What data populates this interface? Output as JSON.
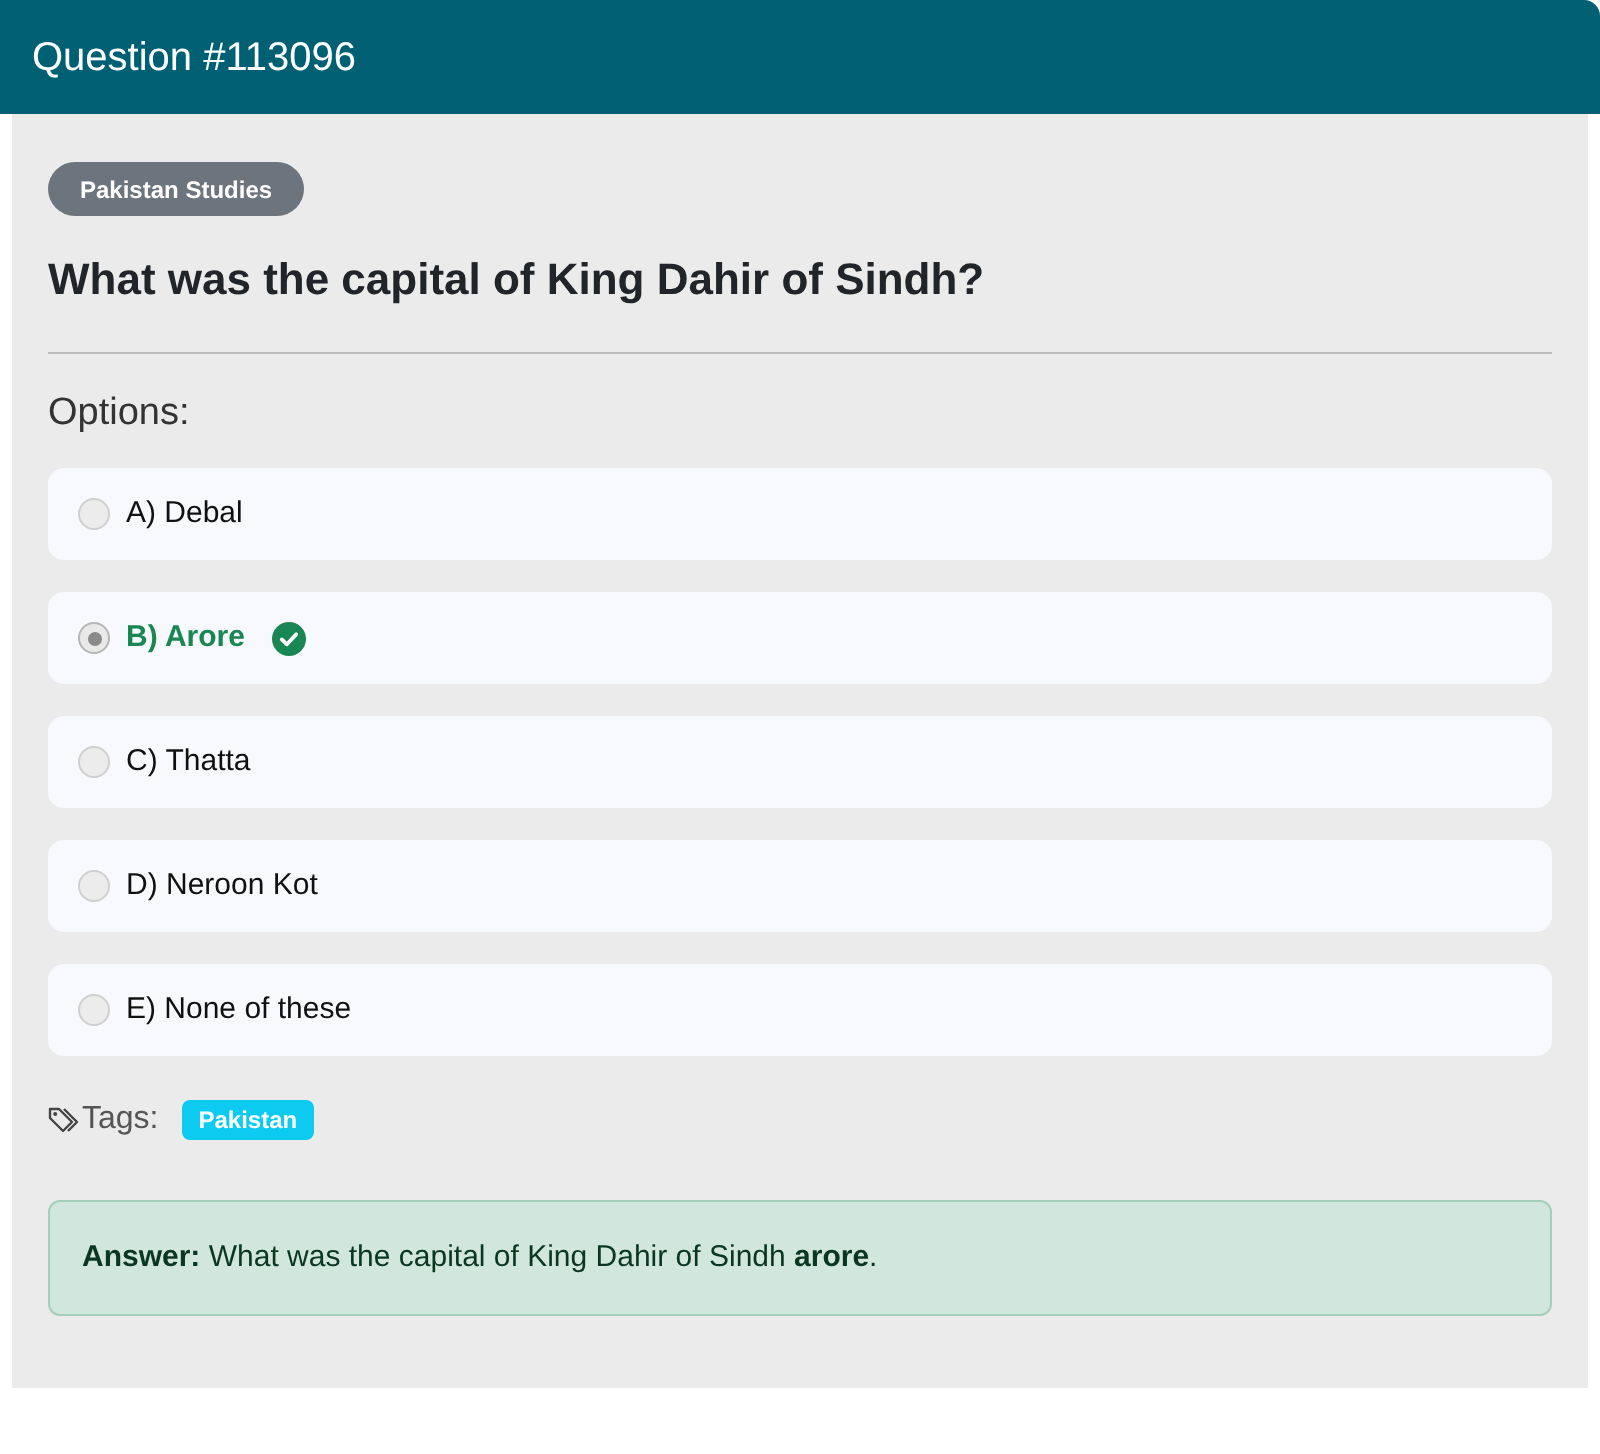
{
  "header": {
    "title": "Question #113096"
  },
  "category": "Pakistan Studies",
  "question": "What was the capital of King Dahir of Sindh?",
  "options_label": "Options:",
  "options": [
    {
      "label": "A) Debal",
      "selected": false,
      "correct": false
    },
    {
      "label": "B) Arore",
      "selected": true,
      "correct": true
    },
    {
      "label": "C) Thatta",
      "selected": false,
      "correct": false
    },
    {
      "label": "D) Neroon Kot",
      "selected": false,
      "correct": false
    },
    {
      "label": "E) None of these",
      "selected": false,
      "correct": false
    }
  ],
  "tags_label": "Tags:",
  "tags": [
    "Pakistan"
  ],
  "answer": "**Answer:** What was the capital of King Dahir of Sindh **arore**."
}
